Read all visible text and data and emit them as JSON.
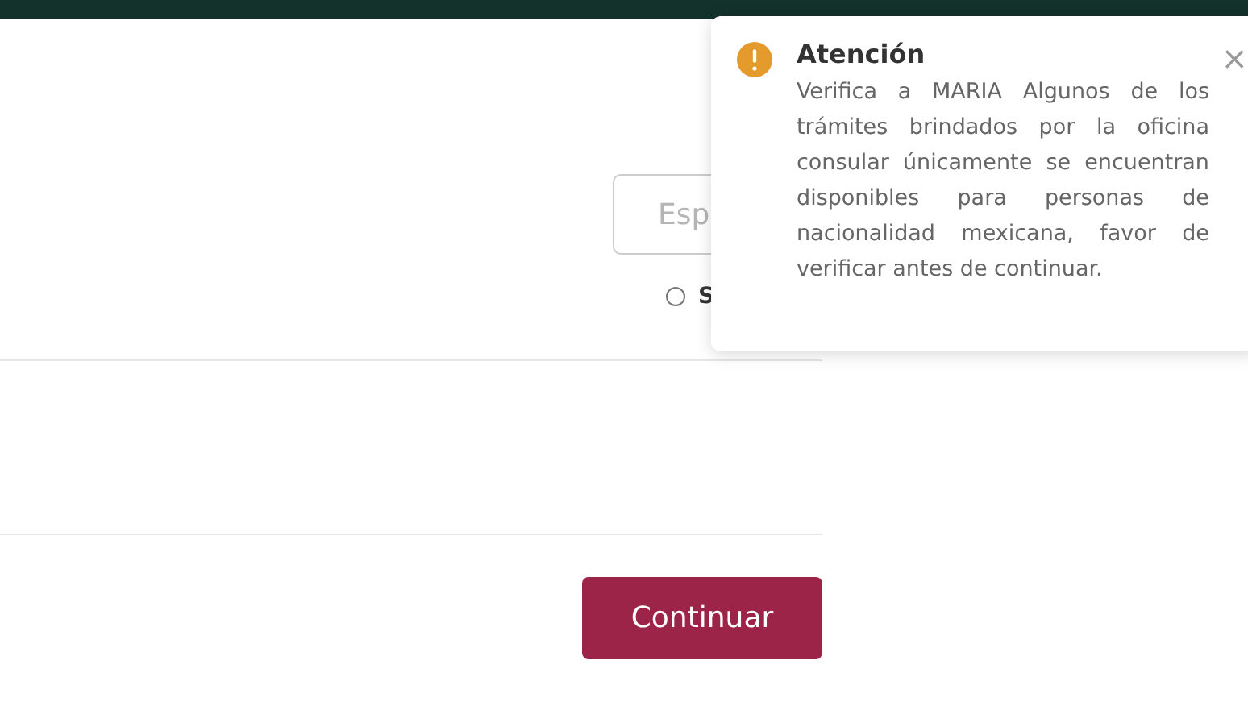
{
  "search": {
    "placeholder": "Esp"
  },
  "radio": {
    "label": "S",
    "selected": false
  },
  "button": "Continuar",
  "toast": {
    "title": "Atención",
    "message": "Verifica a MARIA Algunos de los trámites brindados por la oficina consular únicamente se encuentran disponibles para personas de nacionalidad mexicana, favor de verificar antes de continuar.",
    "close": "×"
  }
}
